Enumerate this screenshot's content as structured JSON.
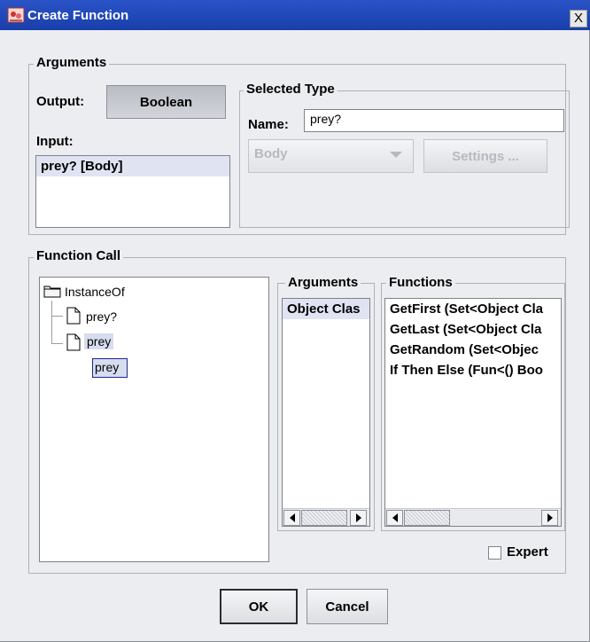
{
  "window": {
    "title": "Create Function",
    "close_glyph": "X"
  },
  "arguments_group": {
    "title": "Arguments",
    "output_label": "Output:",
    "output_value": "Boolean",
    "input_label": "Input:",
    "input_items": [
      "prey? [Body]"
    ]
  },
  "selected_type": {
    "title": "Selected Type",
    "name_label": "Name:",
    "name_value": "prey?",
    "type_combo": "Body",
    "settings_button": "Settings ..."
  },
  "function_call": {
    "title": "Function Call",
    "tree": {
      "root": "InstanceOf",
      "children": [
        "prey?",
        "prey"
      ],
      "editing_value": "prey"
    },
    "arguments_title": "Arguments",
    "arguments_items": [
      "Object Clas"
    ],
    "functions_title": "Functions",
    "functions_items": [
      "GetFirst (Set<Object Cla",
      "GetLast (Set<Object Cla",
      "GetRandom (Set<Objec",
      "If Then Else (Fun<() Boo"
    ],
    "expert_label": "Expert"
  },
  "buttons": {
    "ok": "OK",
    "cancel": "Cancel"
  }
}
